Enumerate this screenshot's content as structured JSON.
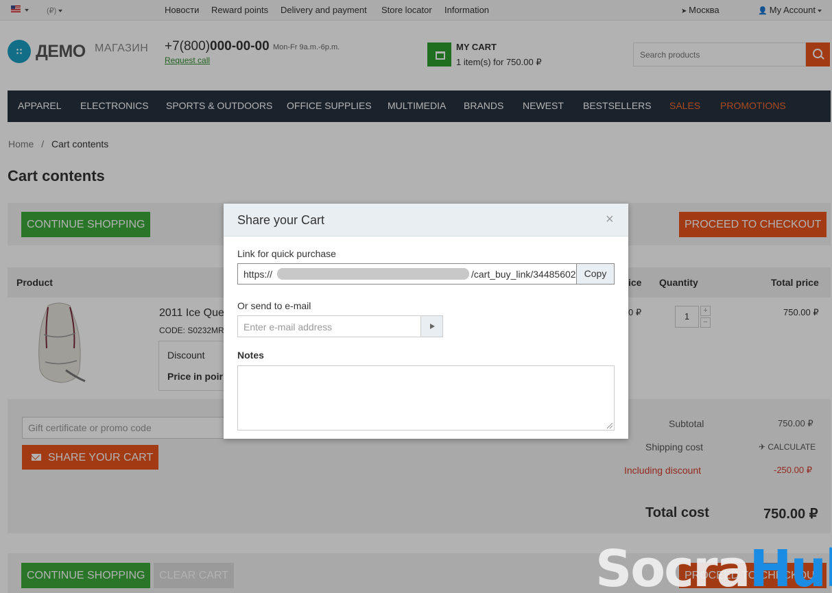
{
  "topbar": {
    "currency": "(₽)",
    "links": [
      "Новости",
      "Reward points",
      "Delivery and payment",
      "Store locator",
      "Information"
    ],
    "city": "Москва",
    "account": "My Account"
  },
  "header": {
    "logo_main": "ДЕМО",
    "logo_sub": "МАГАЗИН",
    "phone_prefix": "+7(800)",
    "phone_number": "000-00-00",
    "hours": "Mon-Fr 9a.m.-6p.m.",
    "request_call": "Request call",
    "cart_title": "MY CART",
    "cart_info": "1 item(s) for 750.00 ₽",
    "search_placeholder": "Search products"
  },
  "nav": {
    "items": [
      "APPAREL",
      "ELECTRONICS",
      "SPORTS & OUTDOORS",
      "OFFICE SUPPLIES",
      "MULTIMEDIA",
      "BRANDS",
      "NEWEST",
      "BESTSELLERS",
      "SALES",
      "PROMOTIONS"
    ]
  },
  "breadcrumb": {
    "home": "Home",
    "sep": "/",
    "current": "Cart contents"
  },
  "page_title": "Cart contents",
  "buttons": {
    "continue": "CONTINUE SHOPPING",
    "checkout": "PROCEED TO CHECKOUT",
    "clear": "CLEAR CART",
    "share": "SHARE YOUR CART"
  },
  "table": {
    "headers": {
      "product": "Product",
      "price": "ice",
      "quantity": "Quantity",
      "total": "Total price"
    },
    "row": {
      "name": "2011 Ice Que",
      "code": "CODE: S0232MR",
      "discount_label": "Discount",
      "points_label": "Price in poir",
      "price": "0 ₽",
      "quantity": "1",
      "total": "750.00 ₽"
    }
  },
  "summary": {
    "promo_placeholder": "Gift certificate or promo code",
    "subtotal_label": "Subtotal",
    "subtotal_value": "750.00 ₽",
    "shipping_label": "Shipping cost",
    "shipping_value": "CALCULATE",
    "discount_label": "Including discount",
    "discount_value": "-250.00 ₽",
    "total_label": "Total cost",
    "total_value": "750.00 ₽"
  },
  "modal": {
    "title": "Share your Cart",
    "close": "×",
    "link_label": "Link for quick purchase",
    "link_prefix": "https://",
    "link_suffix": "/cart_buy_link/34485602",
    "copy": "Copy",
    "email_label": "Or send to e-mail",
    "email_placeholder": "Enter e-mail address",
    "notes_label": "Notes"
  },
  "watermark": {
    "part1": "Socra",
    "part2": "Hub"
  },
  "colors": {
    "accent_orange": "#e8541e",
    "accent_green": "#3caa3c",
    "nav_bg": "#263240",
    "watermark_blue": "#1b8ce3"
  }
}
